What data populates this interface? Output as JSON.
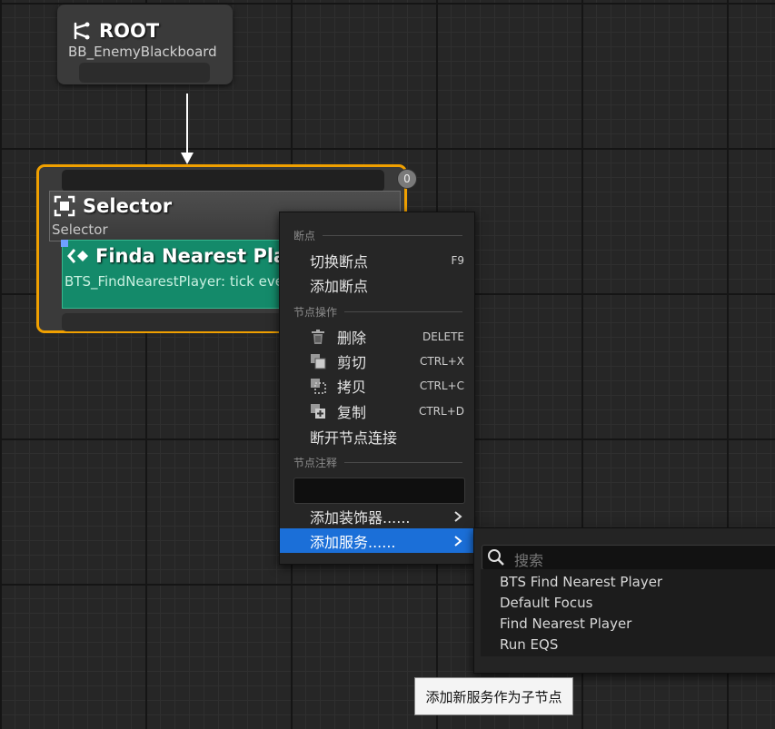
{
  "root_node": {
    "title": "ROOT",
    "subtitle": "BB_EnemyBlackboard",
    "icon": "tree-branch-icon"
  },
  "selector_node": {
    "title": "Selector",
    "subtitle": "Selector",
    "badge": "0",
    "icon": "selector-icon",
    "accent_color": "#f0a000",
    "service": {
      "title": "Finda Nearest Player",
      "subtitle": "BTS_FindNearestPlayer: tick every 0.40-0.60s",
      "icon": "service-icon",
      "color": "#148a6a"
    }
  },
  "context_menu": {
    "section_breakpoints": "断点",
    "toggle_breakpoint": {
      "label": "切换断点",
      "shortcut": "F9"
    },
    "add_breakpoint": {
      "label": "添加断点"
    },
    "section_node_actions": "节点操作",
    "delete": {
      "label": "删除",
      "shortcut": "DELETE",
      "icon": "trash-icon"
    },
    "cut": {
      "label": "剪切",
      "shortcut": "CTRL+X",
      "icon": "cut-icon"
    },
    "copy": {
      "label": "拷贝",
      "shortcut": "CTRL+C",
      "icon": "copy-icon"
    },
    "duplicate": {
      "label": "复制",
      "shortcut": "CTRL+D",
      "icon": "duplicate-icon"
    },
    "break_links": {
      "label": "断开节点连接"
    },
    "section_node_comment": "节点注释",
    "comment_value": "",
    "add_decorator": {
      "label": "添加装饰器......"
    },
    "add_service": {
      "label": "添加服务......"
    },
    "highlight_color": "#1b6fd8"
  },
  "service_submenu": {
    "search_placeholder": "搜索",
    "items": [
      "BTS Find Nearest Player",
      "Default Focus",
      "Find Nearest Player",
      "Run EQS"
    ]
  },
  "tooltip": {
    "text": "添加新服务作为子节点"
  }
}
